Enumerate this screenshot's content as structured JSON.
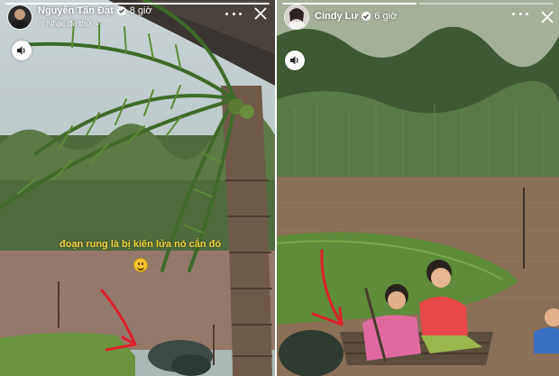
{
  "left_story": {
    "author_name": "Nguyễn Tấn Đạt",
    "time": "8 giờ",
    "music_label": "Nhạc đề thử",
    "caption_text": "đoạn rung là bị kiến lửa nó cắn đó",
    "icons": {
      "verified": "verified-badge-icon",
      "music": "music-note-icon",
      "sound": "speaker-icon",
      "more": "more-dots-icon",
      "close": "close-icon",
      "emoji": "grinning-emoji-icon",
      "annotation": "red-arrow"
    }
  },
  "right_story": {
    "author_name": "Cindy Lư",
    "time": "6 giờ",
    "icons": {
      "verified": "verified-badge-icon",
      "sound": "speaker-icon",
      "more": "more-dots-icon",
      "close": "close-icon",
      "annotation": "red-arrow"
    }
  },
  "colors": {
    "caption": "#f2d33a",
    "annotation_arrow": "#e0202a",
    "water": "#8a7056",
    "foliage": "#4f6b3c"
  }
}
